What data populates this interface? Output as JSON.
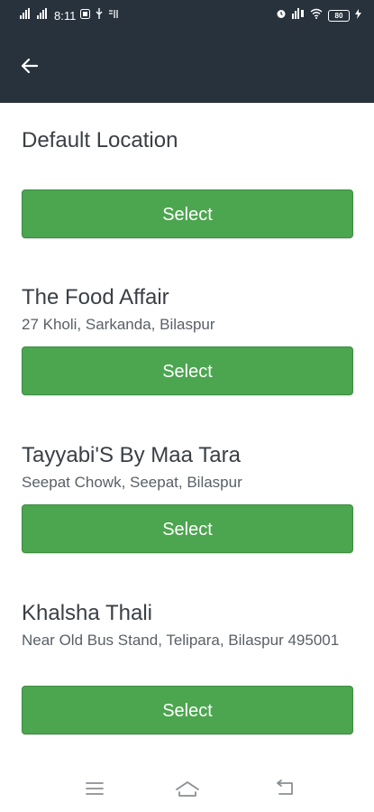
{
  "status_bar": {
    "time": "8:11",
    "battery": "80"
  },
  "header": {
    "back_icon": "arrow-left-icon"
  },
  "default_location": {
    "title": "Default Location",
    "button_label": "Select"
  },
  "locations": [
    {
      "name": "The Food Affair",
      "address": "27 Kholi, Sarkanda, Bilaspur",
      "button_label": "Select"
    },
    {
      "name": "Tayyabi'S By Maa Tara",
      "address": "Seepat Chowk, Seepat, Bilaspur",
      "button_label": "Select"
    },
    {
      "name": "Khalsha Thali",
      "address": "Near Old Bus Stand, Telipara, Bilaspur 495001",
      "button_label": "Select"
    }
  ],
  "colors": {
    "header_bg": "#28323d",
    "button_green": "#4ca54f"
  }
}
